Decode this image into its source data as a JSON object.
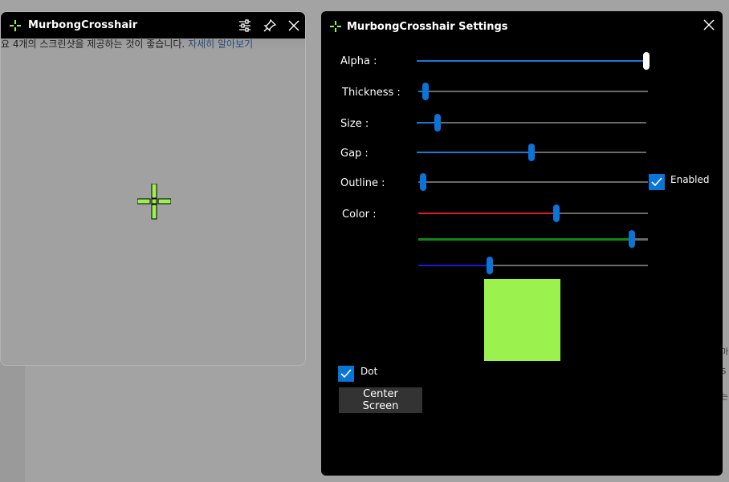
{
  "preview": {
    "title": "MurbongCrosshair",
    "background_text_a": "요 4개의 스크린샷을 제공하는 것이 좋습니다.",
    "background_text_link": " 자세히 알아보기"
  },
  "background_right": {
    "line1": "마",
    "line2": "S",
    "line3": "는"
  },
  "settings": {
    "title": "MurbongCrosshair Settings",
    "sliders": {
      "alpha": {
        "label": "Alpha :",
        "value": 1.0
      },
      "thickness": {
        "label": "Thickness :",
        "value": 0.03
      },
      "size": {
        "label": "Size :",
        "value": 0.09
      },
      "gap": {
        "label": "Gap :",
        "value": 0.5
      },
      "outline": {
        "label": "Outline :",
        "value": 0.02
      },
      "red": {
        "value": 0.6,
        "color": "#e01b1b"
      },
      "green": {
        "value": 0.93,
        "color": "#0e8a0e"
      },
      "blue": {
        "value": 0.31,
        "color": "#1818e0"
      }
    },
    "color_label": "Color :",
    "outline_enabled": {
      "label": "Enabled",
      "checked": true
    },
    "dot": {
      "label": "Dot",
      "checked": true
    },
    "center_button": "Center Screen",
    "crosshair_color": "#9bf24f"
  }
}
